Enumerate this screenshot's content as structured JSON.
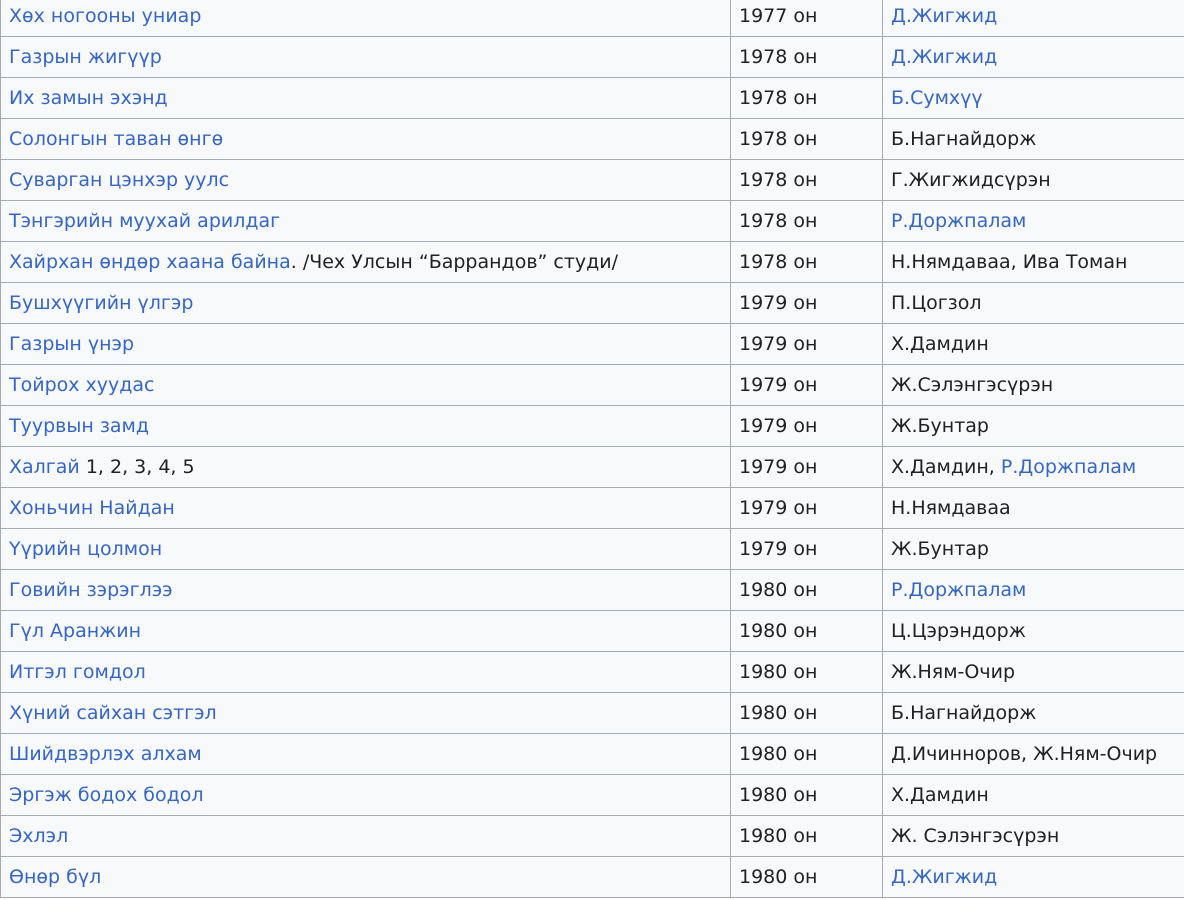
{
  "colors": {
    "link": "#3366cc",
    "text": "#202122",
    "border": "#a2a9b1",
    "cell_bg": "#f8f9fa"
  },
  "rows": [
    {
      "title": [
        {
          "t": "Хөх ногооны униар",
          "link": true
        }
      ],
      "year": "1977 он",
      "authors": [
        {
          "t": "Д.Жигжид",
          "link": true
        }
      ]
    },
    {
      "title": [
        {
          "t": "Газрын жигүүр",
          "link": true
        }
      ],
      "year": "1978 он",
      "authors": [
        {
          "t": "Д.Жигжид",
          "link": true
        }
      ]
    },
    {
      "title": [
        {
          "t": "Их замын эхэнд",
          "link": true
        }
      ],
      "year": "1978 он",
      "authors": [
        {
          "t": "Б.Сумхүү",
          "link": true
        }
      ]
    },
    {
      "title": [
        {
          "t": "Солонгын таван өнгө",
          "link": true
        }
      ],
      "year": "1978 он",
      "authors": [
        {
          "t": "Б.Нагнайдорж",
          "link": false
        }
      ]
    },
    {
      "title": [
        {
          "t": "Суварган цэнхэр уулс",
          "link": true
        }
      ],
      "year": "1978 он",
      "authors": [
        {
          "t": "Г.Жигжидсүрэн",
          "link": false
        }
      ]
    },
    {
      "title": [
        {
          "t": "Тэнгэрийн муухай арилдаг",
          "link": true
        }
      ],
      "year": "1978 он",
      "authors": [
        {
          "t": "Р.Доржпалам",
          "link": true
        }
      ]
    },
    {
      "title": [
        {
          "t": "Хайрхан өндөр хаана байна",
          "link": true
        },
        {
          "t": ". /Чех Улсын “Баррандов” студи/",
          "link": false
        }
      ],
      "year": "1978 он",
      "authors": [
        {
          "t": "Н.Нямдаваа, Ива Томан",
          "link": false
        }
      ]
    },
    {
      "title": [
        {
          "t": "Бушхүүгийн үлгэр",
          "link": true
        }
      ],
      "year": "1979 он",
      "authors": [
        {
          "t": "П.Цогзол",
          "link": false
        }
      ]
    },
    {
      "title": [
        {
          "t": "Газрын үнэр",
          "link": true
        }
      ],
      "year": "1979 он",
      "authors": [
        {
          "t": "Х.Дамдин",
          "link": false
        }
      ]
    },
    {
      "title": [
        {
          "t": "Тойрох хуудас",
          "link": true
        }
      ],
      "year": "1979 он",
      "authors": [
        {
          "t": "Ж.Сэлэнгэсүрэн",
          "link": false
        }
      ]
    },
    {
      "title": [
        {
          "t": "Туурвын замд",
          "link": true
        }
      ],
      "year": "1979 он",
      "authors": [
        {
          "t": "Ж.Бунтар",
          "link": false
        }
      ]
    },
    {
      "title": [
        {
          "t": "Халгай",
          "link": true
        },
        {
          "t": " 1, 2, 3, 4, 5",
          "link": false
        }
      ],
      "year": "1979 он",
      "authors": [
        {
          "t": "Х.Дамдин, ",
          "link": false
        },
        {
          "t": "Р.Доржпалам",
          "link": true
        }
      ]
    },
    {
      "title": [
        {
          "t": "Хоньчин Найдан",
          "link": true
        }
      ],
      "year": "1979 он",
      "authors": [
        {
          "t": "Н.Нямдаваа",
          "link": false
        }
      ]
    },
    {
      "title": [
        {
          "t": "Үүрийн цолмон",
          "link": true
        }
      ],
      "year": "1979 он",
      "authors": [
        {
          "t": "Ж.Бунтар",
          "link": false
        }
      ]
    },
    {
      "title": [
        {
          "t": "Говийн зэрэглээ",
          "link": true
        }
      ],
      "year": "1980 он",
      "authors": [
        {
          "t": "Р.Доржпалам",
          "link": true
        }
      ]
    },
    {
      "title": [
        {
          "t": "Гүл Аранжин",
          "link": true
        }
      ],
      "year": "1980 он",
      "authors": [
        {
          "t": "Ц.Цэрэндорж",
          "link": false
        }
      ]
    },
    {
      "title": [
        {
          "t": "Итгэл гомдол",
          "link": true
        }
      ],
      "year": "1980 он",
      "authors": [
        {
          "t": "Ж.Ням-Очир",
          "link": false
        }
      ]
    },
    {
      "title": [
        {
          "t": "Хүний сайхан сэтгэл",
          "link": true
        }
      ],
      "year": "1980 он",
      "authors": [
        {
          "t": "Б.Нагнайдорж",
          "link": false
        }
      ]
    },
    {
      "title": [
        {
          "t": "Шийдвэрлэх алхам",
          "link": true
        }
      ],
      "year": "1980 он",
      "authors": [
        {
          "t": "Д.Ичинноров, Ж.Ням-Очир",
          "link": false
        }
      ]
    },
    {
      "title": [
        {
          "t": "Эргэж бодох бодол",
          "link": true
        }
      ],
      "year": "1980 он",
      "authors": [
        {
          "t": "Х.Дамдин",
          "link": false
        }
      ]
    },
    {
      "title": [
        {
          "t": "Эхлэл",
          "link": true
        }
      ],
      "year": "1980 он",
      "authors": [
        {
          "t": "Ж. Сэлэнгэсүрэн",
          "link": false
        }
      ]
    },
    {
      "title": [
        {
          "t": "Өнөр бүл",
          "link": true
        }
      ],
      "year": "1980 он",
      "authors": [
        {
          "t": "Д.Жигжид",
          "link": true
        }
      ]
    }
  ]
}
